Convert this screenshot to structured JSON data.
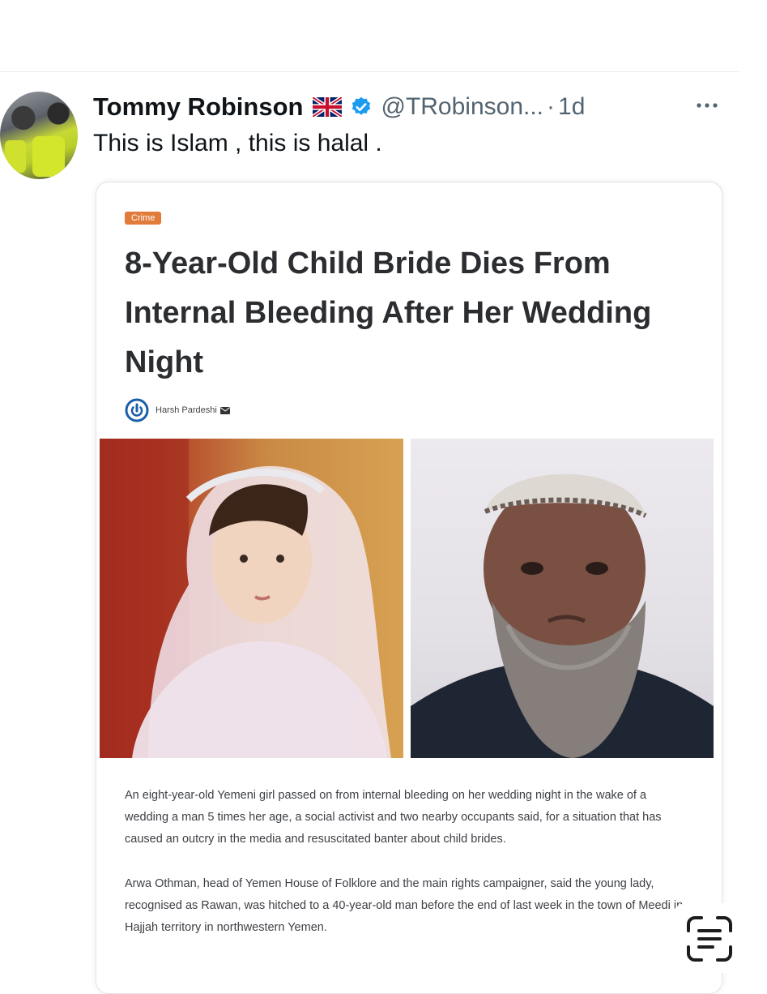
{
  "tweet": {
    "author_name": "Tommy Robinson",
    "handle": "@TRobinson...",
    "separator": "·",
    "time": "1d",
    "text": "This is Islam , this is halal ."
  },
  "card": {
    "category": "Crime",
    "headline": "8-Year-Old Child Bride Dies From Internal Bleeding After Her Wedding Night",
    "author": "Harsh Pardeshi",
    "paragraphs": [
      "An eight-year-old Yemeni girl passed on from internal bleeding on her wedding night in the wake of a wedding a man 5 times her age, a social activist and two nearby occupants said, for a situation that has caused an outcry in the media and resuscitated banter about child brides.",
      "Arwa Othman, head of Yemen House of Folklore and the main rights campaigner, said the young lady, recognised as Rawan, was hitched to a 40-year-old man before the end of last week in the town of Meedi in Hajjah territory in northwestern Yemen."
    ]
  },
  "icons": {
    "flag": "uk-flag-icon",
    "verified": "verified-badge-icon",
    "more": "more-options-icon",
    "scan": "text-scan-icon",
    "mail": "mail-icon"
  },
  "colors": {
    "verified_blue": "#1d9bf0",
    "badge_orange": "#e07b3a",
    "secondary_text": "#536471"
  }
}
